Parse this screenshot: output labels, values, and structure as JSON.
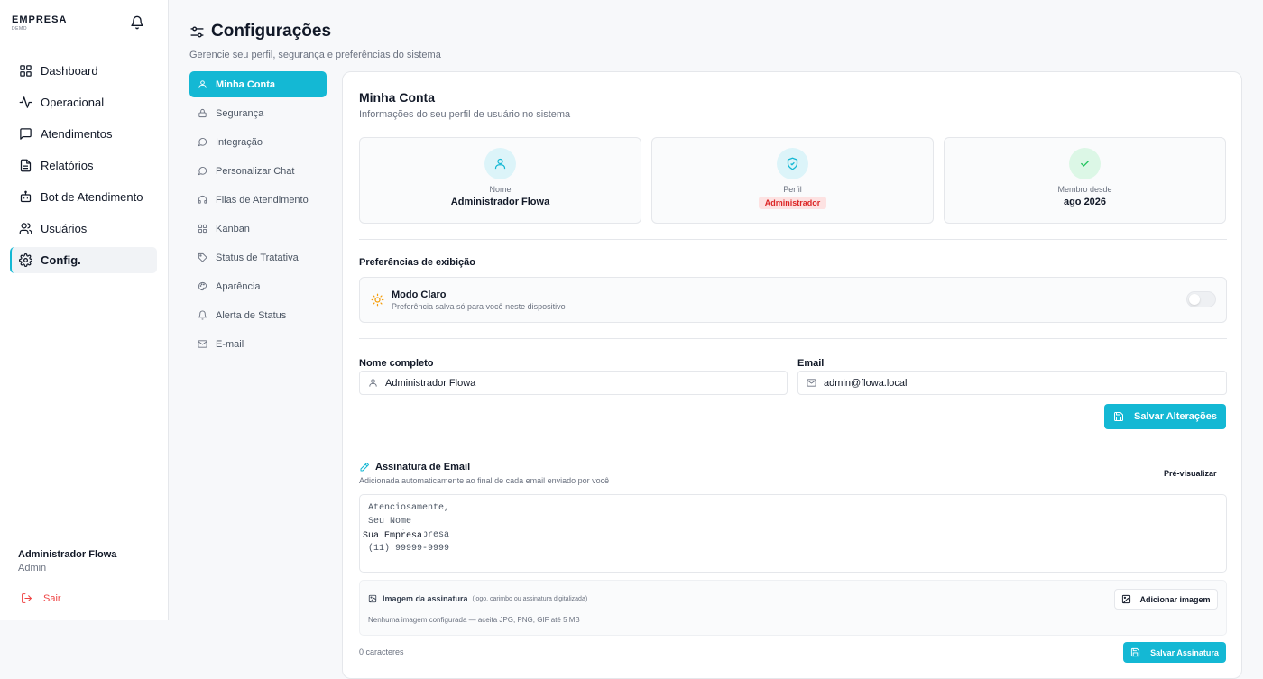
{
  "brand": {
    "name": "EMPRESA",
    "sub": "DEMO"
  },
  "nav": [
    {
      "label": "Dashboard",
      "icon": "dashboard-icon"
    },
    {
      "label": "Operacional",
      "icon": "activity-icon"
    },
    {
      "label": "Atendimentos",
      "icon": "chat-icon"
    },
    {
      "label": "Relatórios",
      "icon": "report-icon"
    },
    {
      "label": "Bot de Atendimento",
      "icon": "bot-icon"
    },
    {
      "label": "Usuários",
      "icon": "users-icon"
    },
    {
      "label": "Config.",
      "icon": "gear-icon",
      "active": true
    }
  ],
  "user": {
    "name": "Administrador Flowa",
    "role": "Admin",
    "logout": "Sair"
  },
  "header": {
    "title": "Configurações",
    "subtitle": "Gerencie seu perfil, segurança e preferências do sistema"
  },
  "settings_menu": [
    {
      "label": "Minha Conta",
      "icon": "user-icon",
      "active": true
    },
    {
      "label": "Segurança",
      "icon": "lock-icon"
    },
    {
      "label": "Integração",
      "icon": "chat-bubble-icon"
    },
    {
      "label": "Personalizar Chat",
      "icon": "chat-bubble-icon"
    },
    {
      "label": "Filas de Atendimento",
      "icon": "headset-icon"
    },
    {
      "label": "Kanban",
      "icon": "grid-icon"
    },
    {
      "label": "Status de Tratativa",
      "icon": "tag-icon"
    },
    {
      "label": "Aparência",
      "icon": "palette-icon"
    },
    {
      "label": "Alerta de Status",
      "icon": "bell-icon"
    },
    {
      "label": "E-mail",
      "icon": "mail-icon"
    }
  ],
  "account": {
    "title": "Minha Conta",
    "subtitle": "Informações do seu perfil de usuário no sistema",
    "cards": [
      {
        "label": "Nome",
        "value": "Administrador Flowa",
        "icon": "user-icon"
      },
      {
        "label": "Perfil",
        "value": "Administrador",
        "icon": "shield-icon"
      },
      {
        "label": "Membro desde",
        "value": "ago 2026",
        "icon": "check-icon"
      }
    ]
  },
  "preferences": {
    "title": "Preferências de exibição",
    "theme_label": "Modo Claro",
    "theme_hint": "Preferência salva só para você neste dispositivo",
    "dark_mode_enabled": false
  },
  "form": {
    "name_label": "Nome completo",
    "name_value": "Administrador Flowa",
    "email_label": "Email",
    "email_value": "admin@flowa.local",
    "save_label": "Salvar Alterações"
  },
  "signature": {
    "title": "Assinatura de Email",
    "subtitle": "Adicionada automaticamente ao final de cada email enviado por você",
    "preview_label": "Pré-visualizar",
    "placeholder": "Atenciosamente,\nSeu Nome\nCargo | Empresa\n(11) 99999-9999",
    "overlay_text": "Sua Empresa",
    "image_title": "Imagem da assinatura",
    "image_hint": "(logo, carimbo ou assinatura digitalizada)",
    "image_empty": "Nenhuma imagem configurada — aceita JPG, PNG, GIF até 5 MB",
    "add_image_label": "Adicionar imagem",
    "char_count": "0 caracteres",
    "save_label": "Salvar Assinatura"
  },
  "colors": {
    "accent": "#14b8d4",
    "danger": "#ef4444"
  }
}
